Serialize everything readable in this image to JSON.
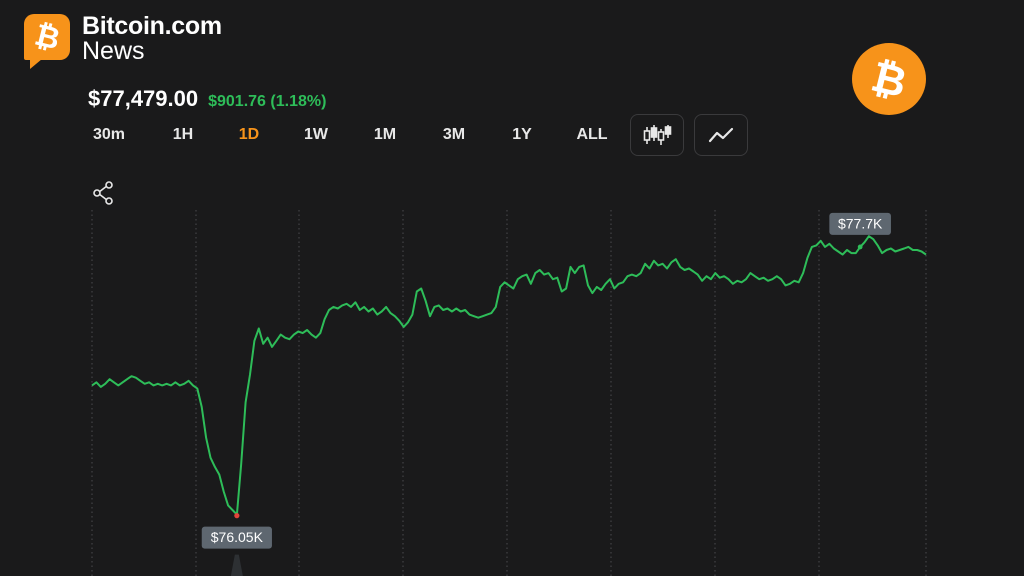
{
  "brand": {
    "name": "Bitcoin.com",
    "sub": "News",
    "logo_icon": "bitcoin-b-icon"
  },
  "coin_icon": "bitcoin-coin-icon",
  "price": {
    "current": "$77,479.00",
    "change": "$901.76 (1.18%)",
    "change_color": "#2ebd59"
  },
  "timeframes": [
    "30m",
    "1H",
    "1D",
    "1W",
    "1M",
    "3M",
    "1Y",
    "ALL"
  ],
  "active_timeframe": "1D",
  "toolbar": {
    "candlestick_icon": "candlestick-chart-icon",
    "line_icon": "line-chart-icon",
    "share_icon": "share-icon"
  },
  "colors": {
    "accent": "#f7931a",
    "line": "#2ebd59",
    "low_marker": "#e0443a",
    "background": "#1a1a1b"
  },
  "chart_data": {
    "type": "line",
    "title": "",
    "xlabel": "",
    "ylabel": "",
    "ylim": [
      75.95,
      77.9
    ],
    "grid": "vertical dotted",
    "series": [
      {
        "values": [
          76.89,
          76.91,
          76.88,
          76.9,
          76.93,
          76.91,
          76.89,
          76.91,
          76.93,
          76.95,
          76.94,
          76.92,
          76.9,
          76.91,
          76.89,
          76.9,
          76.89,
          76.9,
          76.89,
          76.91,
          76.89,
          76.9,
          76.92,
          76.89,
          76.87,
          76.75,
          76.55,
          76.42,
          76.36,
          76.31,
          76.2,
          76.11,
          76.08,
          76.05,
          76.38,
          76.78,
          76.96,
          77.18,
          77.26,
          77.16,
          77.2,
          77.14,
          77.18,
          77.22,
          77.2,
          77.19,
          77.22,
          77.24,
          77.23,
          77.25,
          77.22,
          77.2,
          77.23,
          77.32,
          77.38,
          77.4,
          77.39,
          77.41,
          77.42,
          77.4,
          77.43,
          77.38,
          77.4,
          77.37,
          77.39,
          77.35,
          77.37,
          77.4,
          77.36,
          77.34,
          77.31,
          77.27,
          77.3,
          77.35,
          77.5,
          77.52,
          77.44,
          77.34,
          77.4,
          77.41,
          77.38,
          77.39,
          77.37,
          77.39,
          77.37,
          77.38,
          77.35,
          77.34,
          77.33,
          77.34,
          77.35,
          77.36,
          77.4,
          77.53,
          77.56,
          77.54,
          77.52,
          77.58,
          77.6,
          77.61,
          77.55,
          77.62,
          77.64,
          77.61,
          77.62,
          77.58,
          77.59,
          77.5,
          77.52,
          77.66,
          77.62,
          77.66,
          77.67,
          77.54,
          77.49,
          77.53,
          77.51,
          77.55,
          77.58,
          77.52,
          77.55,
          77.56,
          77.6,
          77.61,
          77.6,
          77.62,
          77.68,
          77.65,
          77.7,
          77.67,
          77.68,
          77.65,
          77.69,
          77.71,
          77.66,
          77.64,
          77.65,
          77.63,
          77.61,
          77.57,
          77.6,
          77.58,
          77.62,
          77.59,
          77.6,
          77.58,
          77.55,
          77.57,
          77.56,
          77.58,
          77.62,
          77.6,
          77.58,
          77.59,
          77.57,
          77.58,
          77.6,
          77.58,
          77.54,
          77.55,
          77.57,
          77.56,
          77.62,
          77.72,
          77.79,
          77.8,
          77.83,
          77.79,
          77.81,
          77.78,
          77.76,
          77.74,
          77.77,
          77.75,
          77.75,
          77.79,
          77.82,
          77.86,
          77.84,
          77.8,
          77.75,
          77.77,
          77.78,
          77.76,
          77.77,
          77.78,
          77.79,
          77.77,
          77.77,
          77.76,
          77.74
        ]
      }
    ],
    "annotations": [
      {
        "label": "$76.05K",
        "index": 33,
        "kind": "low"
      },
      {
        "label": "$77.7K",
        "index": 175,
        "kind": "high"
      }
    ]
  }
}
